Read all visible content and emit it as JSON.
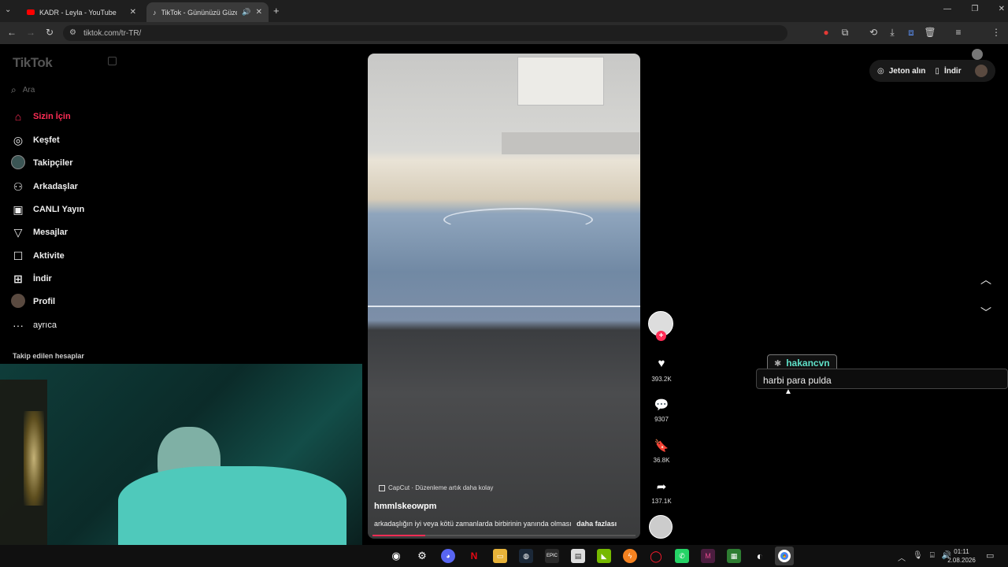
{
  "browser": {
    "tabs": [
      {
        "title": "KADR - Leyla - YouTube",
        "active": false
      },
      {
        "title": "TikTok - Gününüzü Güzelleş",
        "active": true
      }
    ],
    "new_tab": "+",
    "url": "tiktok.com/tr-TR/",
    "window_controls": [
      "—",
      "❐",
      "✕"
    ]
  },
  "tiktok": {
    "logo": "TikTok",
    "search_placeholder": "Ara",
    "nav": [
      {
        "label": "Sizin İçin",
        "icon": "home-icon",
        "active": true
      },
      {
        "label": "Keşfet",
        "icon": "compass-icon"
      },
      {
        "label": "Takipçiler",
        "icon": "followers-avatar-icon"
      },
      {
        "label": "Arkadaşlar",
        "icon": "friends-icon"
      },
      {
        "label": "CANLI Yayın",
        "icon": "live-tv-icon"
      },
      {
        "label": "Mesajlar",
        "icon": "send-icon"
      },
      {
        "label": "Aktivite",
        "icon": "activity-icon"
      },
      {
        "label": "İndir",
        "icon": "download-plus-icon"
      },
      {
        "label": "Profil",
        "icon": "profile-avatar-icon"
      },
      {
        "label": "ayrıca",
        "icon": "more-dots-icon"
      }
    ],
    "following_header": "Takip edilen hesaplar",
    "top_right": {
      "coins": "Jeton alın",
      "download": "İndir"
    },
    "video": {
      "capcut_text": "CapCut · Düzenleme artık daha kolay",
      "author": "hmmlskeowpm",
      "caption": "arkadaşlığın iyi veya kötü zamanlarda birbirinin yanında olması",
      "more": "daha fazlası",
      "progress": 0.2
    },
    "actions": {
      "likes": "393.2K",
      "comments": "9307",
      "saves": "36.8K",
      "shares": "137.1K"
    }
  },
  "chat_overlay": {
    "username": "hakancvn",
    "message": "harbi para pulda"
  },
  "taskbar": {
    "time": "01:11",
    "date": "2.08.2026"
  },
  "colors": {
    "tiktok_accent": "#fe2c55",
    "chat_username": "#5fe0c8"
  }
}
